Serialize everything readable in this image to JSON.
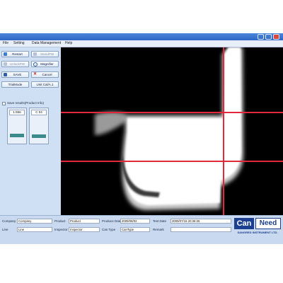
{
  "menu": {
    "items": [
      "File",
      "Setting",
      "Data Management",
      "Help"
    ]
  },
  "toolbar": {
    "restart": "Restart",
    "stand_pw": "StandPW",
    "unlock_pw": "UnlockPW",
    "magnifier": "Magnifier",
    "save": "SAVE",
    "cancel": "Cancel",
    "trial_mode": "TrialMode",
    "unit_mode": "Unit Cal/A.1",
    "save_results": "Save results(Product Info)"
  },
  "gauges": [
    {
      "value": "1.556",
      "level": 0.25
    },
    {
      "value": "C 04",
      "level": 0.22
    }
  ],
  "camera": {
    "description_hidden": ""
  },
  "form": {
    "company_label": "Company",
    "company_value": "Company",
    "product_label": "Product",
    "product_value": "Product",
    "produce_date_label": "Produce Date",
    "produce_date_value": "2009/08/02",
    "test_date_label": "Test Date",
    "test_date_value": "2009/07/16 20:36:26",
    "line_label": "Line",
    "line_value": "Line",
    "inspector_label": "Inspector",
    "inspector_value": "Inspector",
    "can_type_label": "Can Type",
    "can_type_value": "CanType",
    "remark_label": "Remark",
    "remark_value": ""
  },
  "logo": {
    "word1": "Can",
    "word2": "Need",
    "tagline": "SANGRED INSTRUMENT LTD."
  },
  "colors": {
    "accent": "#2f67c4",
    "crosshair": "#e2283a",
    "logo_blue": "#1d3f8f"
  }
}
